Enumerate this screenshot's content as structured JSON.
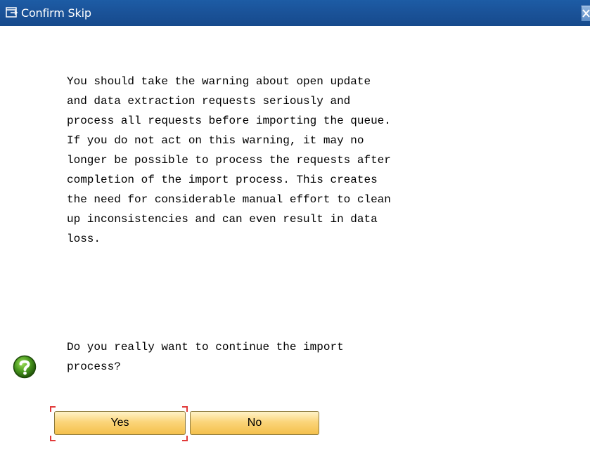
{
  "window": {
    "title": "Confirm Skip",
    "close_label": "×"
  },
  "message": {
    "lines": [
      "You should take the warning about open update",
      "and data extraction requests seriously and",
      "process all requests before importing the queue.",
      "If you do not act on this warning, it may no",
      "longer be possible to process the requests after",
      "completion of the import process. This creates",
      "the need for considerable manual effort to clean",
      "up inconsistencies and can even result in data",
      "loss."
    ]
  },
  "question": {
    "lines": [
      "Do you really want to continue the import",
      "process?"
    ]
  },
  "buttons": {
    "yes_label": "Yes",
    "no_label": "No"
  },
  "colors": {
    "titlebar": "#1a5298",
    "button_fill": "#fbd57a",
    "focus_bracket": "#e13a3a",
    "question_icon": "#4a9a1e"
  },
  "icons": {
    "title": "dialog-window-icon",
    "close": "close-icon",
    "question": "question-icon"
  }
}
